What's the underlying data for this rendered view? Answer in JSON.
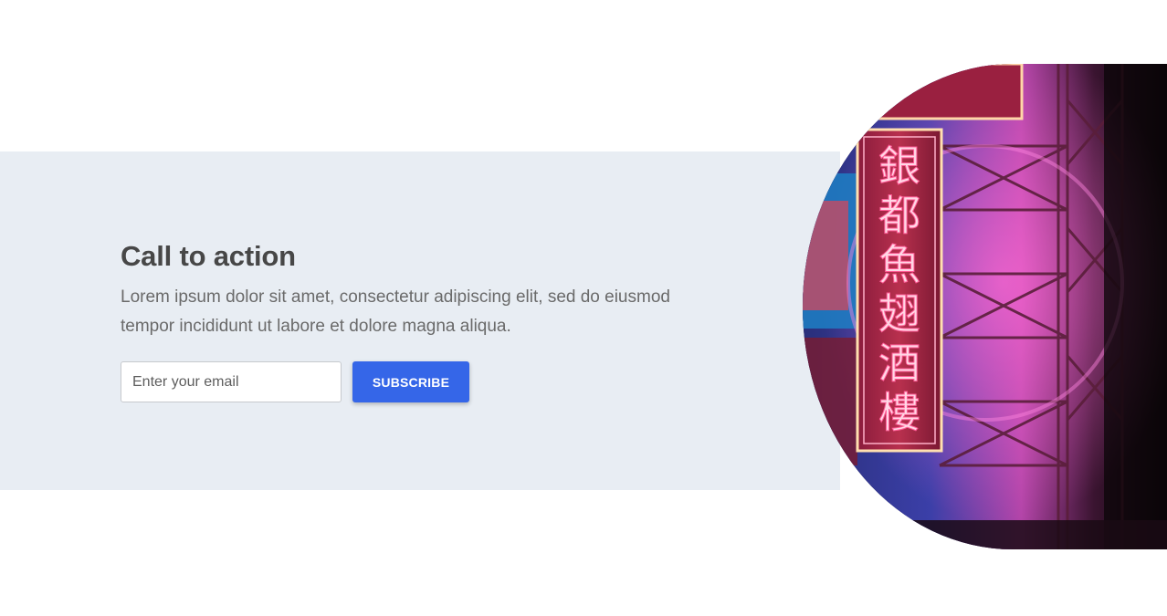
{
  "cta": {
    "title": "Call to action",
    "body": "Lorem ipsum dolor sit amet, consectetur adipiscing elit, sed do eiusmod tempor incididunt ut labore et dolore magna aliqua."
  },
  "form": {
    "email_placeholder": "Enter your email",
    "subscribe_label": "SUBSCRIBE"
  },
  "colors": {
    "band_background": "#e8edf3",
    "button_primary": "#3566e8",
    "title_text": "#474747",
    "body_text": "#6a6a6a"
  },
  "image": {
    "subject": "neon shop sign at night",
    "sign_characters": [
      "銀",
      "都",
      "魚",
      "翅",
      "酒",
      "樓"
    ]
  }
}
